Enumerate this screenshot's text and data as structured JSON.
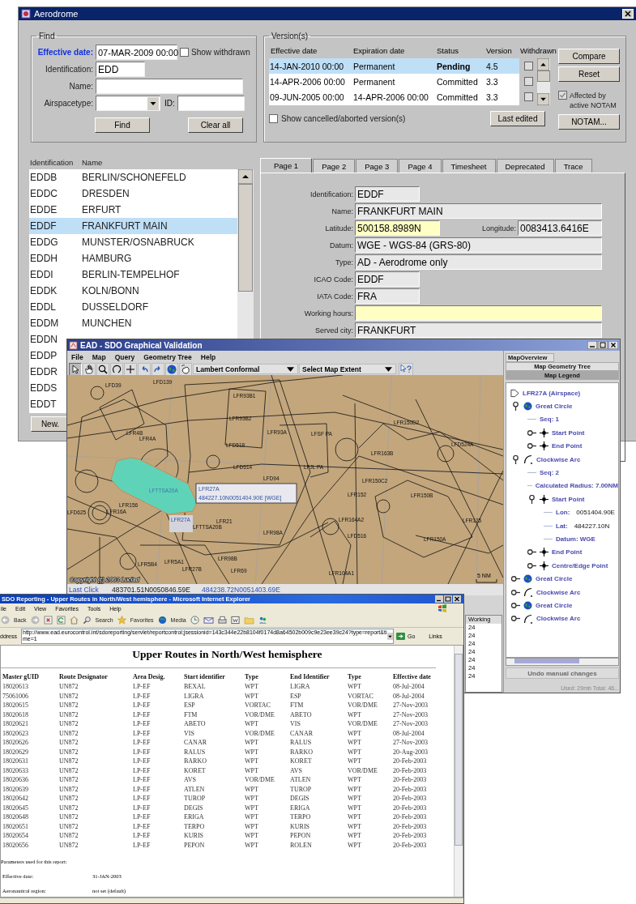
{
  "aerodrome_window": {
    "title": "Aerodrome",
    "find": {
      "legend": "Find",
      "effective_date": {
        "label": "Effective date:",
        "value": "07-MAR-2009 00:00"
      },
      "show_withdrawn": {
        "label": "Show withdrawn",
        "checked": false
      },
      "identification": {
        "label": "Identification:",
        "value": "EDD"
      },
      "name": {
        "label": "Name:"
      },
      "airspacetype": {
        "label": "Airspacetype:"
      },
      "id": {
        "label": "ID:"
      },
      "buttons": [
        "Find",
        "Clear all"
      ]
    },
    "versions": {
      "legend": "Version(s)",
      "columns": [
        "Effective date",
        "Expiration date",
        "Status",
        "Version",
        "Withdrawn"
      ],
      "rows": [
        {
          "effective": "14-JAN-2010 00:00",
          "expiration": "Permanent",
          "status": "Pending",
          "version": "4.5",
          "withdrawn": false,
          "selected": true
        },
        {
          "effective": "14-APR-2006 00:00",
          "expiration": "Permanent",
          "status": "Committed",
          "version": "3.3",
          "withdrawn": false,
          "selected": false
        },
        {
          "effective": "09-JUN-2005 00:00",
          "expiration": "14-APR-2006 00:00",
          "status": "Committed",
          "version": "3.3",
          "withdrawn": false,
          "selected": false
        }
      ],
      "show_cancelled": {
        "label": "Show cancelled/aborted version(s)",
        "checked": false
      },
      "last_edited": "Last edited",
      "buttons": [
        "Compare",
        "Reset"
      ],
      "affected_notam": {
        "label": "Affected by active NOTAM",
        "checked": true,
        "disabled": true
      },
      "notam_button": "NOTAM..."
    },
    "list": {
      "columns": [
        "Identification",
        "Name"
      ],
      "rows": [
        {
          "id": "EDDB",
          "name": "BERLIN/SCHONEFELD",
          "selected": false
        },
        {
          "id": "EDDC",
          "name": "DRESDEN",
          "selected": false
        },
        {
          "id": "EDDE",
          "name": "ERFURT",
          "selected": false
        },
        {
          "id": "EDDF",
          "name": "FRANKFURT MAIN",
          "selected": true
        },
        {
          "id": "EDDG",
          "name": "MUNSTER/OSNABRUCK",
          "selected": false
        },
        {
          "id": "EDDH",
          "name": "HAMBURG",
          "selected": false
        },
        {
          "id": "EDDI",
          "name": "BERLIN-TEMPELHOF",
          "selected": false
        },
        {
          "id": "EDDK",
          "name": "KOLN/BONN",
          "selected": false
        },
        {
          "id": "EDDL",
          "name": "DUSSELDORF",
          "selected": false
        },
        {
          "id": "EDDM",
          "name": "MUNCHEN",
          "selected": false
        },
        {
          "id": "EDDN",
          "selected": false
        },
        {
          "id": "EDDP",
          "selected": false
        },
        {
          "id": "EDDR",
          "selected": false
        },
        {
          "id": "EDDS",
          "selected": false
        },
        {
          "id": "EDDT",
          "selected": false
        }
      ],
      "new_button": "New."
    },
    "tabs": [
      {
        "label": "Page 1",
        "selected": true
      },
      {
        "label": "Page 2",
        "selected": false
      },
      {
        "label": "Page 3",
        "selected": false
      },
      {
        "label": "Page 4",
        "selected": false
      },
      {
        "label": "Timesheet",
        "selected": false
      },
      {
        "label": "Deprecated",
        "selected": false
      },
      {
        "label": "Trace",
        "selected": false
      }
    ],
    "form": [
      {
        "kind": "short",
        "label": "Identification:",
        "value": "EDDF",
        "mandatory": false
      },
      {
        "kind": "wide",
        "label": "Name:",
        "value": "FRANKFURT MAIN",
        "mandatory": false
      },
      {
        "kind": "pair",
        "fields": [
          {
            "label": "Latitude:",
            "value": "500158.8989N",
            "mandatory": true
          },
          {
            "label": "Longitude:",
            "value": "0083413.6416E",
            "mandatory": false
          }
        ]
      },
      {
        "kind": "wide",
        "label": "Datum:",
        "value": "WGE - WGS-84 (GRS-80)",
        "mandatory": false
      },
      {
        "kind": "wide",
        "label": "Type:",
        "value": "AD - Aerodrome only",
        "mandatory": false
      },
      {
        "kind": "short",
        "label": "ICAO Code:",
        "value": "EDDF",
        "mandatory": false
      },
      {
        "kind": "short",
        "label": "IATA Code:",
        "value": "FRA",
        "mandatory": false
      },
      {
        "kind": "wide",
        "label": "Working hours:",
        "mandatory": true
      },
      {
        "kind": "wide",
        "label": "Served city:",
        "value": "FRANKFURT",
        "mandatory": false
      }
    ]
  },
  "map_window": {
    "title": "EAD - SDO Graphical Validation",
    "menu": [
      "File",
      "Map",
      "Query",
      "Geometry Tree",
      "Help"
    ],
    "projection": "Lambert Conformal",
    "extent": "Select Map Extent",
    "map_labels": [
      "LFD39",
      "LFD139",
      "LFR4B",
      "LFR4A",
      "LFR93B1",
      "LFR93B2",
      "LFD518",
      "LFD514",
      "LFR93A",
      "LFSF PA",
      "LFJL PA",
      "LFD94",
      "LFR150D2",
      "LFR163B",
      "LFD524A",
      "LFR150C2",
      "LFR152",
      "LFR150B",
      "LFTTSA20A",
      "LFR156",
      "LFD625",
      "LFR16A",
      "LFR21",
      "LFTTSA20B",
      "LFR98A",
      "LFR164A2",
      "LFD516",
      "LFR150A",
      "LFR125",
      "LFR98B",
      "LFR5B4",
      "LFR5A1",
      "LFR27B",
      "LFR69",
      "LFR104A1"
    ],
    "selected_label": "LFR27A",
    "tooltip": [
      "LFR27A",
      "484227.10N0051404.90E [WGE]"
    ],
    "copyright": "Copyright (c) 2003 Luciad",
    "scale": "5 NM",
    "status": {
      "label": "Last Click",
      "value": "483701.51N0050846.59E",
      "value_2": "484238.72N0051403.69E"
    },
    "working": {
      "header": "Working",
      "rows": [
        "24",
        "24",
        "24",
        "24",
        "24",
        "24",
        "24"
      ]
    },
    "panel_tabs": [
      {
        "label": "MapOverview",
        "selected": false
      },
      {
        "label": "Map Geometry Tree",
        "selected": false
      },
      {
        "label": "Map Legend",
        "selected": true
      }
    ],
    "tree_root": "LFR27A (Airspace)",
    "tree": [
      {
        "kind": "globe",
        "label": "Great Circle",
        "expanded": true,
        "children": [
          {
            "label": "Seq: 1"
          },
          {
            "kind": "point",
            "label": "Start Point",
            "expanded": false
          },
          {
            "kind": "point",
            "label": "End Point",
            "expanded": false
          }
        ]
      },
      {
        "kind": "arc",
        "label": "Clockwise Arc",
        "expanded": true,
        "children": [
          {
            "label": "Seq: 2"
          },
          {
            "label": "Calculated Radius: 7.00NM"
          },
          {
            "kind": "point",
            "label": "Start Point",
            "expanded": true,
            "children": [
              {
                "label": "Lon:",
                "value": "0051404.90E"
              },
              {
                "label": "Lat:",
                "value": "484227.10N"
              },
              {
                "label": "Datum: WGE"
              }
            ]
          },
          {
            "kind": "point",
            "label": "End Point",
            "expanded": false
          },
          {
            "kind": "point",
            "label": "Centre/Edge Point",
            "expanded": false
          }
        ]
      },
      {
        "kind": "globe",
        "label": "Great Circle",
        "expanded": false
      },
      {
        "kind": "arc",
        "label": "Clockwise Arc",
        "expanded": false
      },
      {
        "kind": "globe",
        "label": "Great Circle",
        "expanded": false
      },
      {
        "kind": "arc",
        "label": "Clockwise Arc",
        "expanded": false
      }
    ],
    "undo_button": {
      "label": "Undo manual changes",
      "disabled": true
    },
    "memory": "Used: 29mb Total: 46..."
  },
  "browser_window": {
    "title": "SDO Reporting - Upper Routes in North/West hemisphere - Microsoft Internet Explorer",
    "menu": [
      "ile",
      "Edit",
      "View",
      "Favorites",
      "Tools",
      "Help"
    ],
    "toolbar": [
      "Back",
      "Search",
      "Favorites",
      "Media"
    ],
    "address_label": "ddress",
    "url": "http://www.ead.eurocontrol.int/sdoreporting/servlet/reportcontrol;jsessionid=143c344e22b8104f0174d8a64502b009c9e23ee39c24?type=report&time=1",
    "go": "Go",
    "links": "Links",
    "heading": "Upper Routes in North/West hemisphere",
    "columns": [
      "Master gUID",
      "Route Designator",
      "Area Desig.",
      "Start identifier",
      "Type",
      "End Identifier",
      "Type",
      "Effective date"
    ],
    "rows": [
      [
        "18020613",
        "UN872",
        "LP-EF",
        "BEXAL",
        "WPT",
        "LIGRA",
        "WPT",
        "08-Jul-2004"
      ],
      [
        "75061006",
        "UN872",
        "LP-EF",
        "LIGRA",
        "WPT",
        "ESP",
        "VORTAC",
        "08-Jul-2004"
      ],
      [
        "18020615",
        "UN872",
        "LP-EF",
        "ESP",
        "VORTAC",
        "FTM",
        "VOR/DME",
        "27-Nov-2003"
      ],
      [
        "18020618",
        "UN872",
        "LP-EF",
        "FTM",
        "VOR/DME",
        "ABETO",
        "WPT",
        "27-Nov-2003"
      ],
      [
        "18020621",
        "UN872",
        "LP-EF",
        "ABETO",
        "WPT",
        "VIS",
        "VOR/DME",
        "27-Nov-2003"
      ],
      [
        "18020623",
        "UN872",
        "LP-EF",
        "VIS",
        "VOR/DME",
        "CANAR",
        "WPT",
        "08-Jul-2004"
      ],
      [
        "18020626",
        "UN872",
        "LP-EF",
        "CANAR",
        "WPT",
        "RALUS",
        "WPT",
        "27-Nov-2003"
      ],
      [
        "18020629",
        "UN872",
        "LP-EF",
        "RALUS",
        "WPT",
        "BARKO",
        "WPT",
        "20-Aug-2003"
      ],
      [
        "18020631",
        "UN872",
        "LP-EF",
        "BARKO",
        "WPT",
        "KORET",
        "WPT",
        "20-Feb-2003"
      ],
      [
        "18020633",
        "UN872",
        "LP-EF",
        "KORET",
        "WPT",
        "AVS",
        "VOR/DME",
        "20-Feb-2003"
      ],
      [
        "18020636",
        "UN872",
        "LP-EF",
        "AVS",
        "VOR/DME",
        "ATLEN",
        "WPT",
        "20-Feb-2003"
      ],
      [
        "18020639",
        "UN872",
        "LP-EF",
        "ATLEN",
        "WPT",
        "TUROP",
        "WPT",
        "20-Feb-2003"
      ],
      [
        "18020642",
        "UN872",
        "LP-EF",
        "TUROP",
        "WPT",
        "DEGIS",
        "WPT",
        "20-Feb-2003"
      ],
      [
        "18020645",
        "UN872",
        "LP-EF",
        "DEGIS",
        "WPT",
        "ERIGA",
        "WPT",
        "20-Feb-2003"
      ],
      [
        "18020648",
        "UN872",
        "LP-EF",
        "ERIGA",
        "WPT",
        "TERPO",
        "WPT",
        "20-Feb-2003"
      ],
      [
        "18020651",
        "UN872",
        "LP-EF",
        "TERPO",
        "WPT",
        "KURIS",
        "WPT",
        "20-Feb-2003"
      ],
      [
        "18020654",
        "UN872",
        "LP-EF",
        "KURIS",
        "WPT",
        "PEPON",
        "WPT",
        "20-Feb-2003"
      ],
      [
        "18020656",
        "UN872",
        "LP-EF",
        "PEPON",
        "WPT",
        "ROLEN",
        "WPT",
        "20-Feb-2003"
      ]
    ],
    "parameters_title": "Parameters used for this report:",
    "parameters": [
      {
        "label": "Effective date:",
        "value": "31-JAN-2003"
      },
      {
        "label": "Aeronautical region:",
        "value": "not set (default)"
      }
    ]
  }
}
